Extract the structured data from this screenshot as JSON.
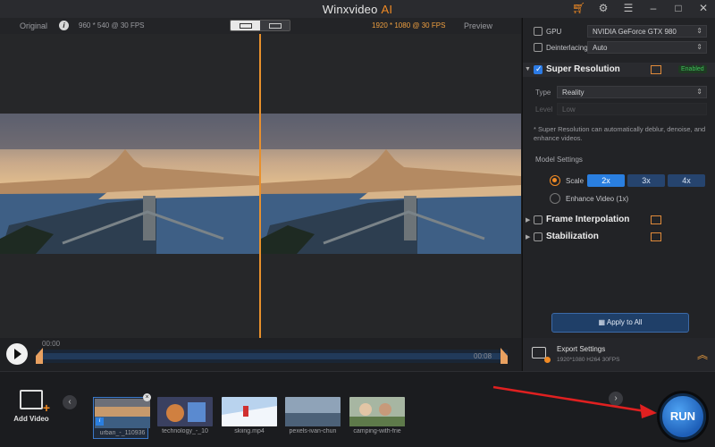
{
  "app": {
    "title": "Winxvideo",
    "title_suffix": "AI"
  },
  "window_controls": [
    "cart-icon",
    "gear-icon",
    "menu-icon",
    "minimize-icon",
    "maximize-icon",
    "close-icon"
  ],
  "preview": {
    "original_label": "Original",
    "original_res": "960 * 540 @ 30 FPS",
    "output_res": "1920 * 1080 @ 30 FPS",
    "preview_label": "Preview"
  },
  "timeline": {
    "start": "00:00",
    "end": "00:08"
  },
  "panel": {
    "gpu_label": "GPU",
    "gpu_value": "NVIDIA GeForce GTX 980",
    "deinterlacing_label": "Deinterlacing",
    "deinterlacing_value": "Auto",
    "super_resolution": {
      "title": "Super Resolution",
      "badge": "Enabled",
      "type_label": "Type",
      "type_value": "Reality",
      "level_label": "Level",
      "level_value": "Low",
      "note": "* Super Resolution can automatically deblur, denoise, and enhance videos.",
      "model_settings": "Model Settings",
      "scale_label": "Scale",
      "scales": [
        "2x",
        "3x",
        "4x"
      ],
      "enhance_label": "Enhance Video (1x)"
    },
    "frame_interpolation": "Frame Interpolation",
    "stabilization": "Stabilization",
    "apply_all": "Apply to All"
  },
  "export": {
    "title": "Export Settings",
    "details": "1920*1080  H264  30FPS"
  },
  "strip": {
    "add_video": "Add Video",
    "thumbnails": [
      {
        "name": "urban_-_110936"
      },
      {
        "name": "technology_-_10"
      },
      {
        "name": "skiing.mp4"
      },
      {
        "name": "pexels-ivan-chun"
      },
      {
        "name": "camping-with-frie"
      }
    ]
  },
  "run_label": "RUN",
  "colors": {
    "accent": "#f08a24",
    "primary": "#2a7fe0",
    "annotation_arrow": "#e02020"
  }
}
